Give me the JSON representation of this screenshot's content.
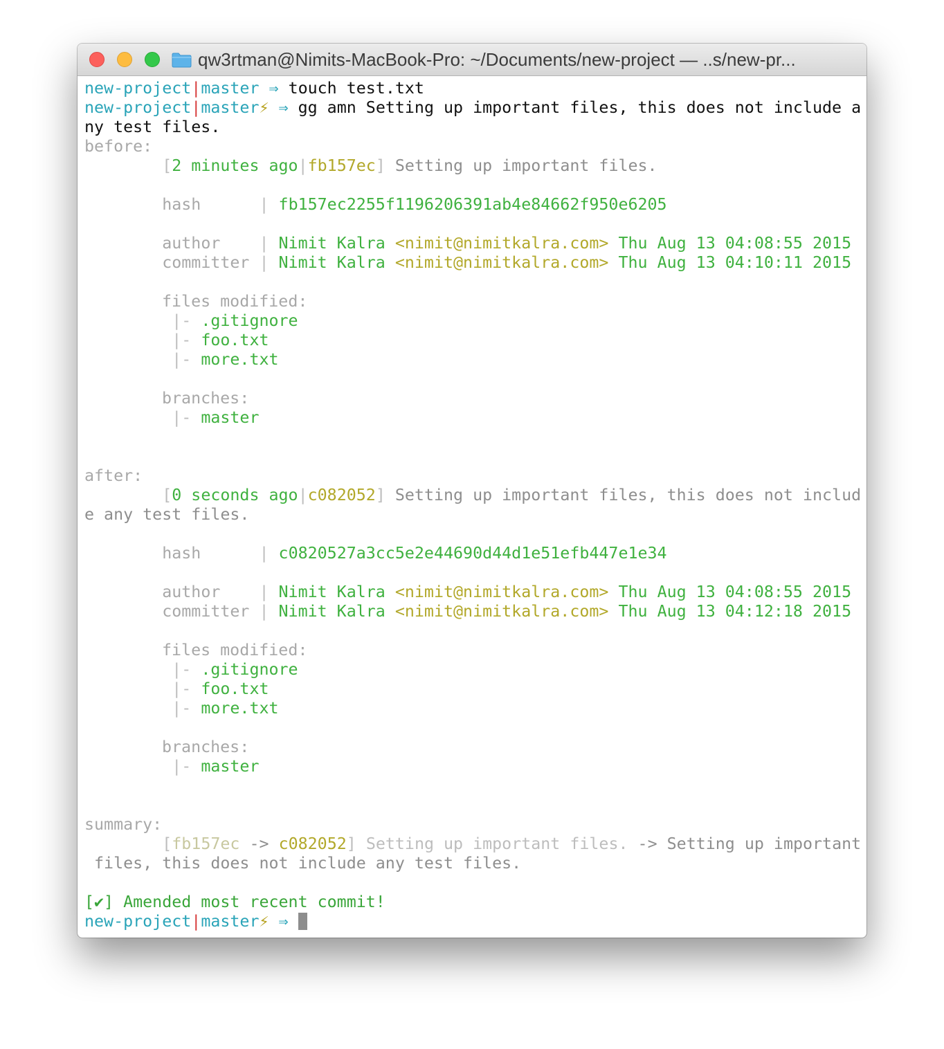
{
  "window": {
    "title": "qw3rtman@Nimits-MacBook-Pro: ~/Documents/new-project — ..s/new-pr..."
  },
  "prompt": {
    "dir": "new-project",
    "sep": "|",
    "branch": "master",
    "dirty": "⚡",
    "arrow": "⇒"
  },
  "commands": {
    "first": "touch test.txt",
    "second_line1": "gg amn Setting up important files, this does not include a",
    "second_line2": "ny test files."
  },
  "labels": {
    "before": "before:",
    "after": "after:",
    "summary": "summary:",
    "hash": "hash",
    "author": "author",
    "committer": "committer",
    "files_modified": "files modified:",
    "branches": "branches:",
    "tree": "|-"
  },
  "before": {
    "ago": "2 minutes ago",
    "short": "fb157ec",
    "message": "Setting up important files.",
    "hash": "fb157ec2255f1196206391ab4e84662f950e6205",
    "author_name": "Nimit Kalra",
    "author_email": "<nimit@nimitkalra.com>",
    "author_date": "Thu Aug 13 04:08:55 2015",
    "committer_name": "Nimit Kalra",
    "committer_email": "<nimit@nimitkalra.com>",
    "committer_date": "Thu Aug 13 04:10:11 2015",
    "files": [
      ".gitignore",
      "foo.txt",
      "more.txt"
    ],
    "branches": [
      "master"
    ]
  },
  "after": {
    "ago": "0 seconds ago",
    "short": "c082052",
    "message_line1": "Setting up important files, this does not includ",
    "message_line2": "e any test files.",
    "hash": "c0820527a3cc5e2e44690d44d1e51efb447e1e34",
    "author_name": "Nimit Kalra",
    "author_email": "<nimit@nimitkalra.com>",
    "author_date": "Thu Aug 13 04:08:55 2015",
    "committer_name": "Nimit Kalra",
    "committer_email": "<nimit@nimitkalra.com>",
    "committer_date": "Thu Aug 13 04:12:18 2015",
    "files": [
      ".gitignore",
      "foo.txt",
      "more.txt"
    ],
    "branches": [
      "master"
    ]
  },
  "summary": {
    "old_short": "fb157ec",
    "arrow": "->",
    "new_short": "c082052",
    "old_message": "Setting up important files.",
    "new_message_line1": "Setting up important",
    "new_message_line2": " files, this does not include any test files."
  },
  "result": {
    "message": "[✔] Amended most recent commit!"
  }
}
